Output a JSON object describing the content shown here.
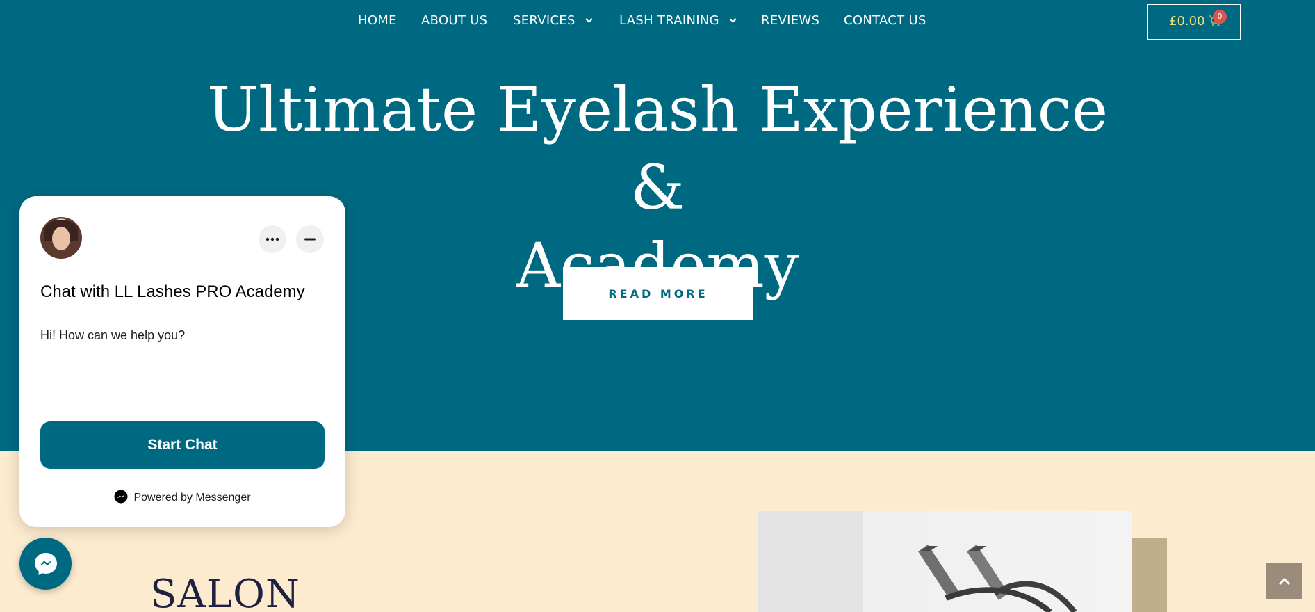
{
  "nav": {
    "items": [
      {
        "label": "HOME"
      },
      {
        "label": "ABOUT US"
      },
      {
        "label": "SERVICES",
        "dropdown": true
      },
      {
        "label": "LASH TRAINING",
        "dropdown": true
      },
      {
        "label": "REVIEWS"
      },
      {
        "label": "CONTACT US"
      }
    ]
  },
  "cart": {
    "amount": "£0.00",
    "count": "0",
    "icon": "cart-icon"
  },
  "hero": {
    "title_line1": "Ultimate Eyelash Experience &",
    "title_line2": "Academy",
    "button_label": "READ MORE"
  },
  "salon": {
    "heading": "SALON"
  },
  "chat": {
    "title": "Chat with LL Lashes PRO Academy",
    "greeting": "Hi! How can we help you?",
    "start_label": "Start Chat",
    "powered_by": "Powered by Messenger",
    "icons": [
      "avatar",
      "more-options-icon",
      "minimize-icon",
      "messenger-icon"
    ]
  },
  "colors": {
    "hero_bg": "#006982",
    "page_bg": "#fdebd0",
    "cart_text": "#f0dc78",
    "badge": "#d9534f",
    "heading_dark": "#1e2140",
    "tan_block": "#c1ae8c"
  }
}
